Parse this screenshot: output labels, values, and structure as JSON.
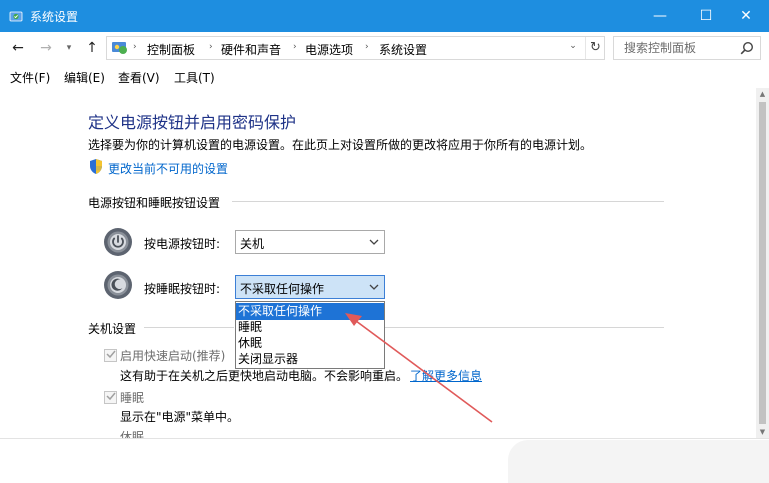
{
  "window": {
    "title": "系统设置",
    "controls": {
      "minimize": "—",
      "maximize": "☐",
      "close": "✕"
    }
  },
  "nav": {
    "back": "←",
    "forward": "→",
    "history": "▾",
    "up": "↑",
    "breadcrumb": [
      "控制面板",
      "硬件和声音",
      "电源选项",
      "系统设置"
    ],
    "breadcrumb_sep": "›",
    "dropdown": "⌄",
    "refresh": "↻",
    "search_placeholder": "搜索控制面板"
  },
  "menu": [
    "文件(F)",
    "编辑(E)",
    "查看(V)",
    "工具(T)"
  ],
  "content": {
    "heading": "定义电源按钮并启用密码保护",
    "description": "选择要为你的计算机设置的电源设置。在此页上对设置所做的更改将应用于你所有的电源计划。",
    "change_link": "更改当前不可用的设置",
    "section_buttons": "电源按钮和睡眠按钮设置",
    "power_button": {
      "label": "按电源按钮时:",
      "value": "关机"
    },
    "sleep_button": {
      "label": "按睡眠按钮时:",
      "value": "不采取任何操作"
    },
    "dropdown_options": [
      "不采取任何操作",
      "睡眠",
      "休眠",
      "关闭显示器"
    ],
    "dropdown_selected_index": 0,
    "section_shutdown": "关机设置",
    "fast_startup": {
      "label": "启用快速启动(推荐)",
      "checked": true,
      "desc_prefix": "这有助于在关机之后更快地启动电脑。不会影响重启。",
      "more_link": "了解更多信息"
    },
    "sleep_option": {
      "label": "睡眠",
      "checked": true,
      "desc": "显示在\"电源\"菜单中。"
    },
    "next_item_partial": "休眠"
  },
  "colors": {
    "titlebar": "#1e8ee0",
    "heading": "#1e3287",
    "link": "#0066cc",
    "selected": "#1e73d6",
    "arrow": "#e05a5a"
  }
}
